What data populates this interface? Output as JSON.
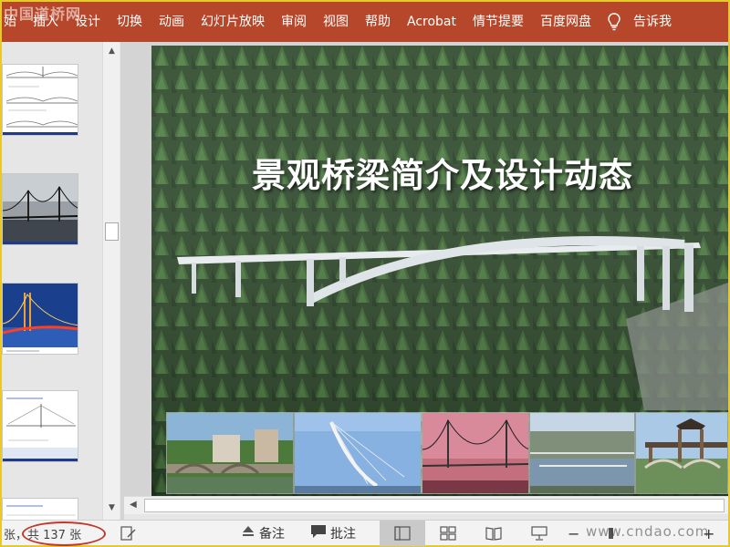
{
  "watermark_top": "中国道桥网",
  "ribbon": {
    "tabs": [
      "始",
      "插入",
      "设计",
      "切换",
      "动画",
      "幻灯片放映",
      "审阅",
      "视图",
      "帮助",
      "Acrobat",
      "情节提要",
      "百度网盘"
    ],
    "tell_me": "告诉我"
  },
  "slide": {
    "title": "景观桥梁简介及设计动态"
  },
  "status": {
    "slide_count": "张，共 137 张",
    "notes_label": "备注",
    "comments_label": "批注",
    "zoom_minus": "−",
    "zoom_plus": "+"
  },
  "watermark_bottom": "www.cndao.com",
  "colors": {
    "ribbon_bg": "#b7472a",
    "status_bg": "#f3f3f3",
    "annotation_ellipse": "#c0392b"
  }
}
